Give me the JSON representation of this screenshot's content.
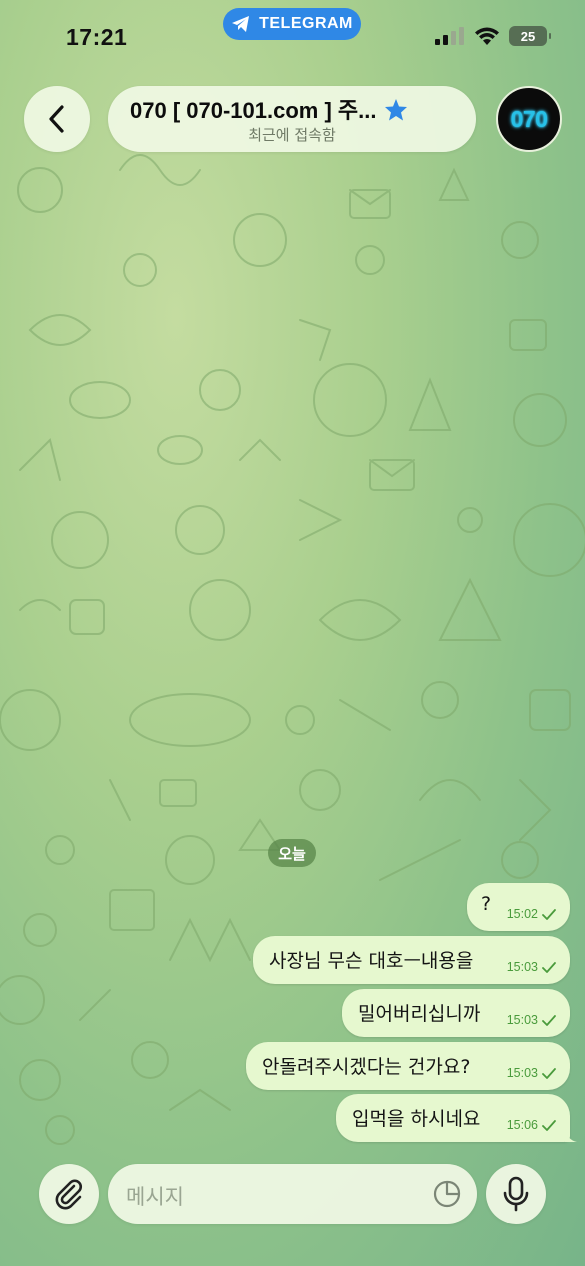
{
  "status_bar": {
    "time": "17:21",
    "app_pill": "TELEGRAM",
    "battery": "25"
  },
  "header": {
    "title": "070 [ 070-101.com ] 주...",
    "subtitle": "최근에 접속함",
    "avatar_text": "070"
  },
  "chat": {
    "date_label": "오늘",
    "messages": [
      {
        "text": "?",
        "time": "15:02"
      },
      {
        "text": "사장님 무슨 대호ㅡ내용을",
        "time": "15:03"
      },
      {
        "text": "밀어버리십니까",
        "time": "15:03"
      },
      {
        "text": "안돌려주시겠다는 건가요?",
        "time": "15:03"
      },
      {
        "text": "입먹을 하시네요",
        "time": "15:06"
      }
    ]
  },
  "composer": {
    "placeholder": "메시지"
  },
  "colors": {
    "accent": "#2f88e6",
    "bubble_out": "#e6f8cf",
    "check": "#4a9b3c"
  },
  "icons": [
    "back-chevron-icon",
    "telegram-plane-icon",
    "signal-icon",
    "wifi-icon",
    "star-icon",
    "attach-icon",
    "sticker-icon",
    "mic-icon",
    "read-check-icon"
  ]
}
